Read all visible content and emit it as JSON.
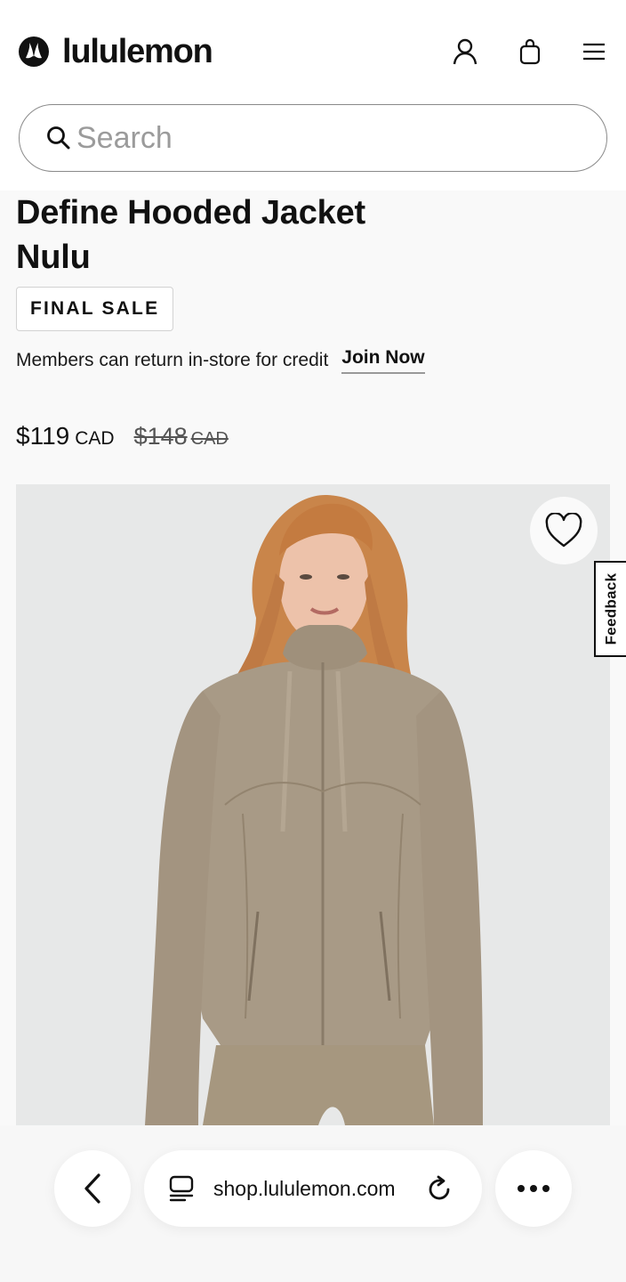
{
  "header": {
    "brand": "lululemon",
    "icons": [
      "lululemon-logo-icon",
      "account-icon",
      "bag-icon",
      "menu-icon"
    ]
  },
  "search": {
    "placeholder": "Search",
    "value": ""
  },
  "product": {
    "title": "Define Hooded Jacket Nulu",
    "badge": "FINAL SALE",
    "members_text": "Members can return in-store for credit",
    "join_label": "Join Now",
    "price_now": "$119",
    "price_now_currency": "CAD",
    "price_was": "$148",
    "price_was_currency": "CAD"
  },
  "feedback_label": "Feedback",
  "browser": {
    "url": "shop.lululemon.com",
    "icons": [
      "back-icon",
      "tabs-icon",
      "reload-icon",
      "more-icon"
    ]
  },
  "colors": {
    "jacket": "#a89a86",
    "image_bg": "#e7e8e8",
    "hair": "#c9854a"
  }
}
